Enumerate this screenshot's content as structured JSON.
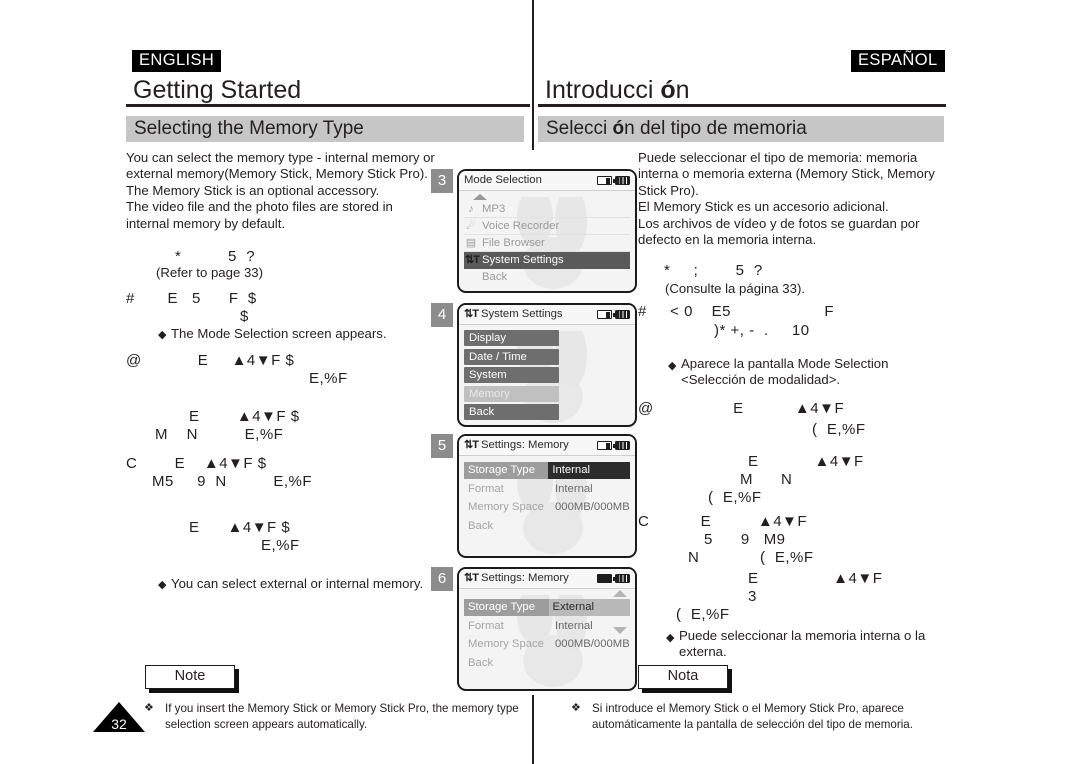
{
  "page": {
    "number": "32",
    "language_tags": {
      "english": "ENGLISH",
      "spanish": "ESPAÑOL"
    }
  },
  "english": {
    "chapter_title": "Getting Started",
    "section_title": "Selecting the Memory Type",
    "intro": "You can select the memory type - internal memory or\nexternal memory(Memory Stick, Memory Stick Pro).\nThe Memory Stick is an optional accessory.\nThe video file and the photo files are stored in\ninternal memory by default.",
    "garbled_1": "*          5  ?",
    "refer_line": "(Refer to page 33)",
    "garbled_2": "#       E   5      F  $",
    "garbled_2b": "$",
    "bullet_1": "The Mode Selection screen appears.",
    "garbled_3": "@            E     ▲4▼F $",
    "garbled_3b": "E,%F",
    "garbled_4": "E        ▲4▼F $",
    "garbled_4b": "M    N          E,%F",
    "garbled_5": "C        E    ▲4▼F $",
    "garbled_5b": "M5     9  N          E,%F",
    "garbled_6": "E      ▲4▼F $",
    "garbled_6b": "E,%F",
    "bullet_2": "You can select external or internal memory.",
    "note_label": "Note",
    "note_marker": "❖",
    "note_text": "If you insert the Memory Stick or Memory Stick Pro, the memory type\nselection screen appears automatically."
  },
  "spanish": {
    "chapter_title_pre": "Introducci ",
    "chapter_title_accent": "ó",
    "chapter_title_post": "n",
    "section_title_pre": "Selecci ",
    "section_title_accent": "ó",
    "section_title_post": "n del tipo de memoria",
    "intro": "Puede seleccionar el tipo de memoria: memoria\ninterna o memoria externa (Memory Stick, Memory\nStick Pro).\nEl Memory Stick es un accesorio adicional.\nLos archivos de vídeo y de fotos se guardan por\ndefecto en la memoria interna.",
    "garbled_1": "*     ;        5  ?",
    "refer_line": "(Consulte la página 33).",
    "garbled_2": "#     < 0    E5                    F",
    "garbled_2b": ")* +, -  .     10",
    "bullet_1": "Aparece la pantalla Mode Selection\n<Selección de modalidad>.",
    "garbled_3": "@                 E           ▲4▼F",
    "garbled_3b": "(  E,%F",
    "garbled_4": "E            ▲4▼F",
    "garbled_4b": "M      N",
    "garbled_4c": "(  E,%F",
    "garbled_5": "C           E          ▲4▼F",
    "garbled_5b": "5      9   M9",
    "garbled_5c": "N             (  E,%F",
    "garbled_6": "E                ▲4▼F",
    "garbled_6b": "3",
    "garbled_6c": "(  E,%F",
    "bullet_2": "Puede seleccionar la memoria interna o la\nexterna.",
    "note_label": "Nota",
    "note_marker": "❖",
    "note_text": "Si introduce el Memory Stick o el Memory Stick Pro, aparece\nautomáticamente la pantalla de selección del tipo de memoria."
  },
  "screens": [
    {
      "step": "3",
      "title": "Mode Selection",
      "title_icon": "",
      "status_icons": [
        "memory-card-icon",
        "battery-icon"
      ],
      "has_top_arrow": true,
      "rows": [
        {
          "icon": "♪",
          "icon_name": "music-note-icon",
          "label": "MP3",
          "selected": false
        },
        {
          "icon": "♆",
          "icon_name": "microphone-icon",
          "label": "Voice Recorder",
          "selected": false
        },
        {
          "icon": "▤",
          "icon_name": "file-browser-icon",
          "label": "File Browser",
          "selected": false
        },
        {
          "icon": "⚙",
          "icon_name": "settings-icon",
          "label": "System Settings",
          "selected": true
        },
        {
          "icon": "",
          "icon_name": "none",
          "label": "Back",
          "selected": false
        }
      ]
    },
    {
      "step": "4",
      "title": "System Settings",
      "title_icon": "settings-icon",
      "status_icons": [
        "memory-card-icon",
        "battery-icon"
      ],
      "pills": [
        {
          "label": "Display",
          "dim": false
        },
        {
          "label": "Date / Time",
          "dim": false
        },
        {
          "label": "System",
          "dim": false
        },
        {
          "label": "Memory",
          "dim": true
        },
        {
          "label": "Back",
          "dim": false
        }
      ]
    },
    {
      "step": "5",
      "title": "Settings: Memory",
      "title_icon": "settings-icon",
      "status_icons": [
        "memory-card-icon",
        "battery-icon"
      ],
      "rows": [
        {
          "key": "Storage Type",
          "value": "Internal",
          "key_highlight": true,
          "value_style": "inverse"
        },
        {
          "key": "Format",
          "value": "Internal",
          "key_highlight": false,
          "value_style": "plain"
        },
        {
          "key": "Memory Space",
          "value": "000MB/000MB",
          "key_highlight": false,
          "value_style": "plain"
        },
        {
          "key": "Back",
          "value": "",
          "key_highlight": false,
          "value_style": "plain"
        }
      ]
    },
    {
      "step": "6",
      "title": "Settings: Memory",
      "title_icon": "settings-icon",
      "status_icons": [
        "memory-card-filled-icon",
        "battery-icon"
      ],
      "has_scroll_arrows": true,
      "rows": [
        {
          "key": "Storage Type",
          "value": "External",
          "key_highlight": true,
          "value_style": "selected"
        },
        {
          "key": "Format",
          "value": "Internal",
          "key_highlight": false,
          "value_style": "plain"
        },
        {
          "key": "Memory Space",
          "value": "000MB/000MB",
          "key_highlight": false,
          "value_style": "plain"
        },
        {
          "key": "Back",
          "value": "",
          "key_highlight": false,
          "value_style": "plain"
        }
      ]
    }
  ],
  "colors": {
    "band_gray": "#c6c6c6",
    "badge_gray": "#8c8c8c",
    "selected_row": "#5a5a5a",
    "ink": "#231f20"
  }
}
